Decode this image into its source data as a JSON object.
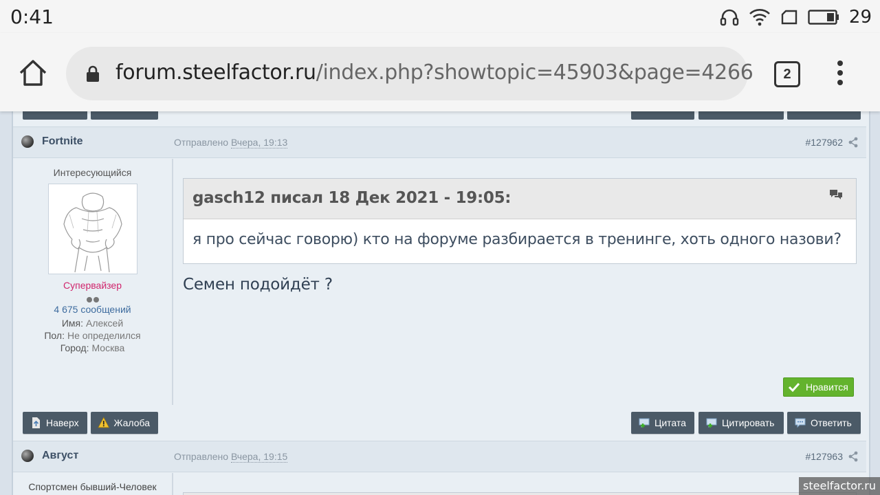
{
  "status_bar": {
    "time": "0:41",
    "battery_level": "29"
  },
  "browser": {
    "url_domain": "forum.steelfactor.ru",
    "url_path": "/index.php?showtopic=45903&page=4266",
    "tab_count": "2"
  },
  "post1": {
    "author": "Fortnite",
    "posted_label": "Отправлено",
    "posted_date": "Вчера, 19:13",
    "post_number": "#127962",
    "user": {
      "title": "Интересующийся",
      "group": "Супервайзер",
      "posts_count": "4 675 сообщений",
      "name_label": "Имя:",
      "name_value": "Алексей",
      "gender_label": "Пол:",
      "gender_value": "Не определился",
      "city_label": "Город:",
      "city_value": "Москва"
    },
    "quote_header": "gasch12 писал 18 Дек 2021 - 19:05:",
    "quote_text": "я про сейчас говорю) кто на форуме разбирается в тренинге, хоть одного назови?",
    "text": "Семен подойдёт ?",
    "like_label": "Нравится"
  },
  "actions": {
    "top_label": "Наверх",
    "report_label": "Жалоба",
    "multiquote_label": "Цитата",
    "quote_label": "Цитировать",
    "reply_label": "Ответить"
  },
  "post2": {
    "author": "Август",
    "posted_label": "Отправлено",
    "posted_date": "Вчера, 19:15",
    "post_number": "#127963",
    "user_title": "Спортсмен бывший-Человек"
  },
  "watermark": "steelfactor.ru",
  "colors": {
    "button_bg": "#4b5a67",
    "like_green": "#63b32d",
    "group_pink": "#d0246c",
    "author_blue": "#3d5066"
  }
}
